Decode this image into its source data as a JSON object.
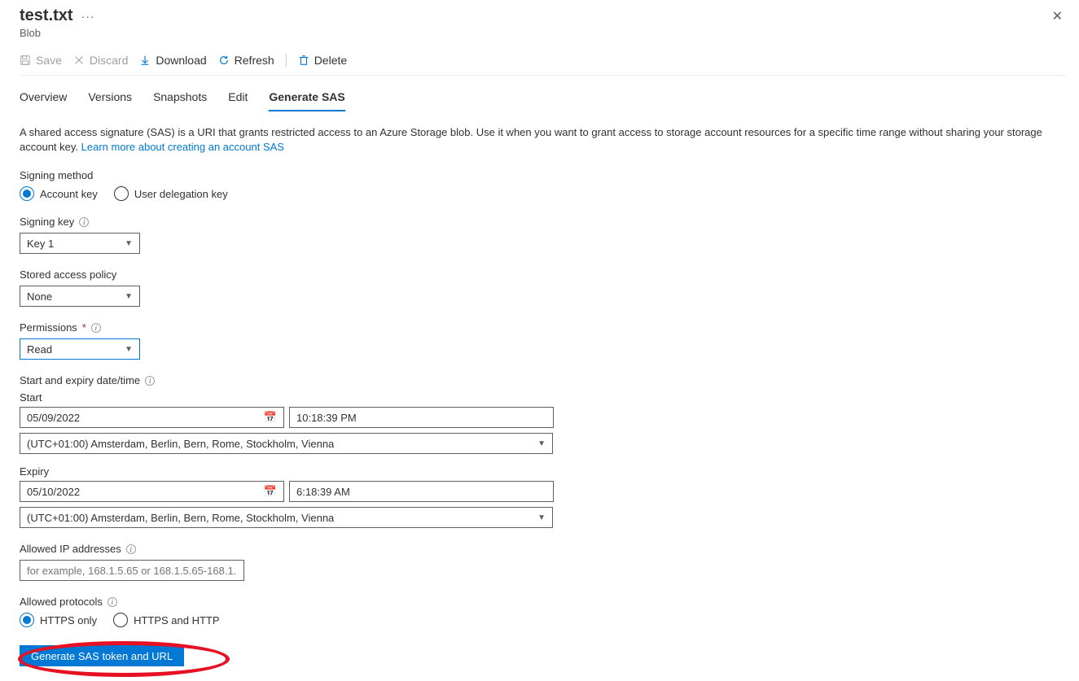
{
  "header": {
    "title": "test.txt",
    "subtitle": "Blob"
  },
  "toolbar": {
    "save": "Save",
    "discard": "Discard",
    "download": "Download",
    "refresh": "Refresh",
    "delete": "Delete"
  },
  "tabs": {
    "overview": "Overview",
    "versions": "Versions",
    "snapshots": "Snapshots",
    "edit": "Edit",
    "generate_sas": "Generate SAS"
  },
  "description": {
    "text": "A shared access signature (SAS) is a URI that grants restricted access to an Azure Storage blob. Use it when you want to grant access to storage account resources for a specific time range without sharing your storage account key. ",
    "link": "Learn more about creating an account SAS"
  },
  "form": {
    "signing_method": {
      "label": "Signing method",
      "opt_account_key": "Account key",
      "opt_user_delegation": "User delegation key"
    },
    "signing_key": {
      "label": "Signing key",
      "value": "Key 1"
    },
    "stored_policy": {
      "label": "Stored access policy",
      "value": "None"
    },
    "permissions": {
      "label": "Permissions",
      "value": "Read"
    },
    "datetime_label": "Start and expiry date/time",
    "start": {
      "label": "Start",
      "date": "05/09/2022",
      "time": "10:18:39 PM",
      "tz": "(UTC+01:00) Amsterdam, Berlin, Bern, Rome, Stockholm, Vienna"
    },
    "expiry": {
      "label": "Expiry",
      "date": "05/10/2022",
      "time": "6:18:39 AM",
      "tz": "(UTC+01:00) Amsterdam, Berlin, Bern, Rome, Stockholm, Vienna"
    },
    "allowed_ip": {
      "label": "Allowed IP addresses",
      "placeholder": "for example, 168.1.5.65 or 168.1.5.65-168.1...."
    },
    "allowed_protocols": {
      "label": "Allowed protocols",
      "opt_https_only": "HTTPS only",
      "opt_https_http": "HTTPS and HTTP"
    },
    "generate_button": "Generate SAS token and URL"
  }
}
